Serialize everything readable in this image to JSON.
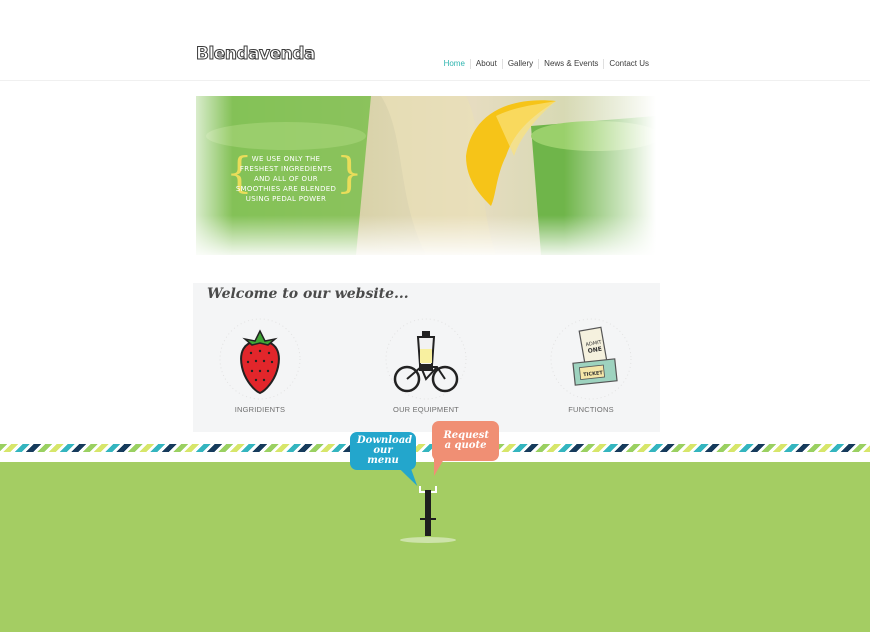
{
  "header": {
    "logo": "Blendavenda",
    "nav": [
      "Home",
      "About",
      "Gallery",
      "News & Events",
      "Contact Us"
    ],
    "active_nav": "Home"
  },
  "hero": {
    "quote": "We use only the freshest ingredients and all of our smoothies are blended using pedal power"
  },
  "welcome": {
    "title": "Welcome to our website...",
    "features": [
      {
        "label": "Ingridients",
        "icon": "strawberry-icon"
      },
      {
        "label": "Our equipment",
        "icon": "bike-blender-icon"
      },
      {
        "label": "Functions",
        "icon": "ticket-icon"
      }
    ]
  },
  "cta": {
    "download": "Download our menu",
    "quote": "Request a quote"
  },
  "colors": {
    "accent_teal": "#2fb5b0",
    "green_band": "#a4cd63",
    "bubble_blue": "#23a6cc",
    "bubble_salmon": "#f08f74",
    "panel_bg": "#f4f5f6"
  }
}
